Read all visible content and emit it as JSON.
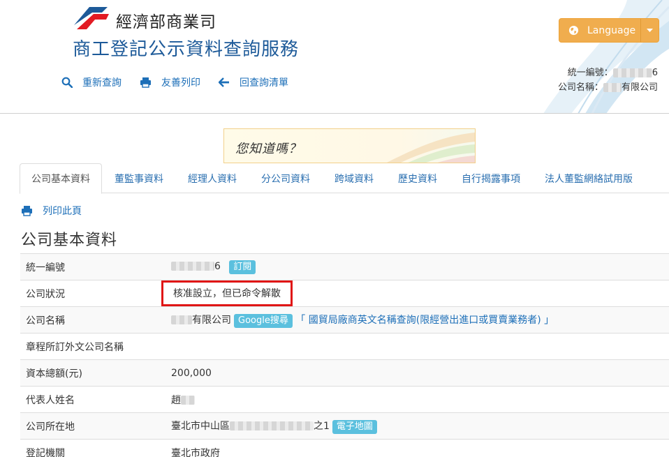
{
  "header": {
    "ministry": "經濟部商業司",
    "service_title": "商工登記公示資料查詢服務",
    "nav": [
      {
        "label": "重新查詢",
        "icon": "search-icon"
      },
      {
        "label": "友善列印",
        "icon": "print-icon"
      },
      {
        "label": "回查詢清單",
        "icon": "arrow-left-icon"
      }
    ],
    "language_label": "Language",
    "ban_label": "統一編號：",
    "ban_tail": "6",
    "company_label": "公司名稱：",
    "company_tail": "有限公司",
    "colors": {
      "brand_blue": "#1d5a99",
      "link_blue": "#1d6fb8",
      "lang_orange": "#f0ad4e",
      "logo_red": "#e21b23"
    }
  },
  "did_you_know": "您知道嗎？",
  "tabs": [
    "公司基本資料",
    "董監事資料",
    "經理人資料",
    "分公司資料",
    "跨域資料",
    "歷史資料",
    "自行揭露事項",
    "法人董監網絡試用版"
  ],
  "print_page": "列印此頁",
  "section_title": "公司基本資料",
  "rows": {
    "ban": {
      "key": "統一編號",
      "tail": "6",
      "badge": "訂閱"
    },
    "status": {
      "key": "公司狀況",
      "value": "核准設立，但已命令解散"
    },
    "name": {
      "key": "公司名稱",
      "tail": "有限公司",
      "badge": "Google搜尋",
      "link": "「 國貿局廠商英文名稱查詢(限經營出進口或買賣業務者) 」"
    },
    "foreign_name": {
      "key": "章程所訂外文公司名稱",
      "value": ""
    },
    "capital": {
      "key": "資本總額(元)",
      "value": "200,000"
    },
    "rep": {
      "key": "代表人姓名",
      "head": "趙"
    },
    "address": {
      "key": "公司所在地",
      "head": "臺北市中山區",
      "tail": "之1",
      "badge": "電子地圖"
    },
    "authority": {
      "key": "登記機關",
      "value": "臺北市政府"
    }
  }
}
